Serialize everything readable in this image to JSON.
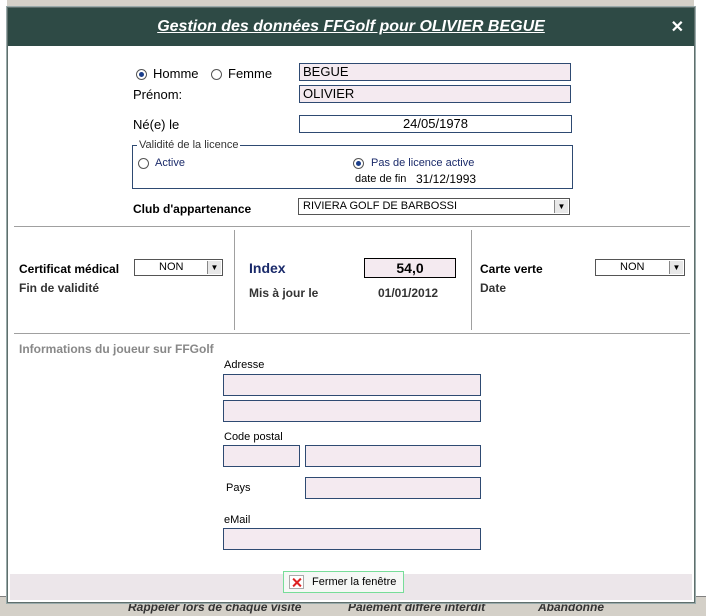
{
  "background": {
    "bottom_items": [
      "Rappeler lors de chaque visite",
      "Paiement différé interdit",
      "Abandonné"
    ]
  },
  "dialog": {
    "title": "Gestion des données FFGolf pour OLIVIER BEGUE",
    "close_symbol": "✕"
  },
  "identity": {
    "gender_male": "Homme",
    "gender_female": "Femme",
    "selected_gender": "Homme",
    "last_name": "BEGUE",
    "first_name_label": "Prénom:",
    "first_name": "OLIVIER",
    "birth_label": "Né(e) le",
    "birth_date": "24/05/1978"
  },
  "licence": {
    "legend": "Validité de la licence",
    "active_label": "Active",
    "no_licence_label": "Pas de licence active",
    "selected": "Pas de licence active",
    "end_date_label": "date de fin",
    "end_date": "31/12/1993"
  },
  "club": {
    "label": "Club d'appartenance",
    "value": "RIVIERA GOLF DE BARBOSSI"
  },
  "medical": {
    "label": "Certificat médical",
    "value": "NON",
    "validity_label": "Fin de validité"
  },
  "index": {
    "label": "Index",
    "value": "54,0",
    "updated_label": "Mis à jour le",
    "updated_date": "01/01/2012"
  },
  "green_card": {
    "label": "Carte verte",
    "value": "NON",
    "date_label": "Date"
  },
  "player_info": {
    "section_title": "Informations du joueur sur FFGolf",
    "address_label": "Adresse",
    "postal_code_label": "Code postal",
    "country_label": "Pays",
    "email_label": "eMail"
  },
  "footer": {
    "close_button": "Fermer la fenêtre"
  },
  "colors": {
    "titlebar": "#2e4a45",
    "field_fill": "#f4eaf0",
    "field_border": "#2e4a72",
    "index_text": "#1a2a6a"
  }
}
